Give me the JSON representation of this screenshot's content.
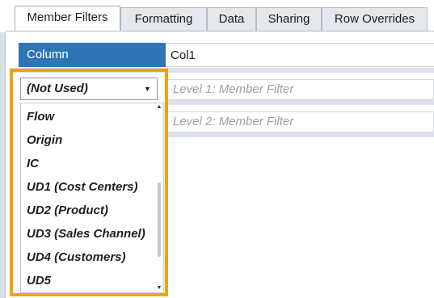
{
  "tabs": [
    {
      "label": "Member Filters",
      "active": true
    },
    {
      "label": "Formatting",
      "active": false
    },
    {
      "label": "Data",
      "active": false
    },
    {
      "label": "Sharing",
      "active": false
    },
    {
      "label": "Row Overrides",
      "active": false
    }
  ],
  "column": {
    "label": "Column",
    "value": "Col1"
  },
  "dropdown": {
    "selected": "(Not Used)",
    "options": [
      "Flow",
      "Origin",
      "IC",
      "UD1 (Cost Centers)",
      "UD2 (Product)",
      "UD3 (Sales Channel)",
      "UD4 (Customers)",
      "UD5"
    ]
  },
  "filters": {
    "level1_placeholder": "Level 1: Member Filter",
    "level2_placeholder": "Level 2: Member Filter"
  },
  "colors": {
    "header_blue": "#2e75b6",
    "highlight_orange": "#f2a20c"
  },
  "icons": {
    "combo_arrow": "dropdown-arrow-icon",
    "scroll_up": "scroll-up-arrow-icon",
    "scroll_down": "scroll-down-arrow-icon"
  }
}
